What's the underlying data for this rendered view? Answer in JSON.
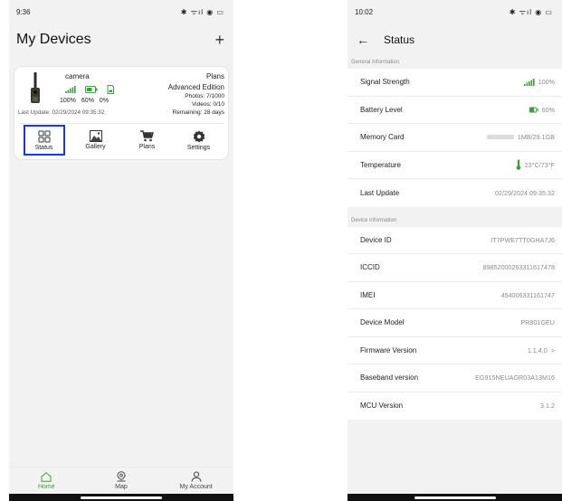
{
  "left": {
    "status_bar": {
      "time": "9:36",
      "icons": "✱ ᯤıl ◉ ▭"
    },
    "header": {
      "title": "My Devices",
      "add_symbol": "+"
    },
    "device": {
      "name": "camera",
      "signal_pct": "100%",
      "battery_pct": "60%",
      "memory_pct": "0%",
      "last_update": "Last Update: 02/29/2024 09:35:32",
      "plans_label": "Plans",
      "plan_name": "Advanced Edition",
      "photos": "Photos: 7/1000",
      "videos": "Videos: 0/10",
      "remaining": "Remaining: 28 days"
    },
    "actions": [
      {
        "label": "Status"
      },
      {
        "label": "Gallery"
      },
      {
        "label": "Plans"
      },
      {
        "label": "Settings"
      }
    ],
    "nav": [
      {
        "label": "Home"
      },
      {
        "label": "Map"
      },
      {
        "label": "My Account"
      }
    ],
    "accent": "#3aa13a",
    "selection_color": "#1d36d6"
  },
  "right": {
    "status_bar": {
      "time": "10:02",
      "icons": "✱ ᯤıl ◉ ▭"
    },
    "header": {
      "title": "Status",
      "back_symbol": "←"
    },
    "general_label": "General Information",
    "general": [
      {
        "label": "Signal Strength",
        "value": "100%",
        "icon": "signal-icon"
      },
      {
        "label": "Battery Level",
        "value": "60%",
        "icon": "battery-icon"
      },
      {
        "label": "Memory Card",
        "value": "1MB/29.1GB",
        "icon": "memory-bar"
      },
      {
        "label": "Temperature",
        "value": "23°C/73°F",
        "icon": "thermometer-icon"
      },
      {
        "label": "Last Update",
        "value": "02/29/2024 09:35:32"
      }
    ],
    "device_label": "Device Information",
    "device": [
      {
        "label": "Device ID",
        "value": "IT7PWE7TT0GHA7J6"
      },
      {
        "label": "ICCID",
        "value": "89852000263311617478"
      },
      {
        "label": "IMEI",
        "value": "454006331161747"
      },
      {
        "label": "Device Model",
        "value": "PR801GEU"
      },
      {
        "label": "Firmware Version",
        "value": "1.1.4.0",
        "chevron": ">"
      },
      {
        "label": "Baseband version",
        "value": "EG915NEUAGR03A13M16"
      },
      {
        "label": "MCU Version",
        "value": "3.1.2"
      }
    ],
    "accent": "#3aa13a"
  }
}
